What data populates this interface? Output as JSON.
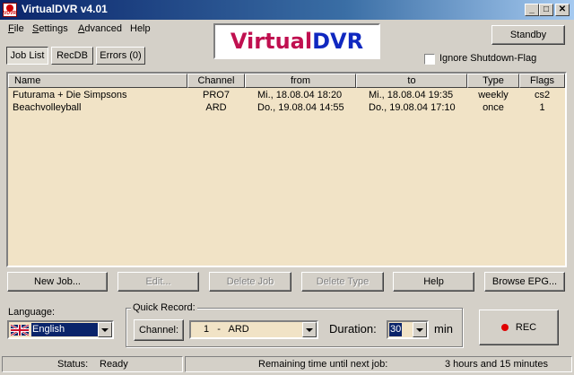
{
  "window": {
    "title": "VirtualDVR v4.01"
  },
  "menu": [
    {
      "label": "File",
      "accel": "F",
      "rest": "ile"
    },
    {
      "label": "Settings",
      "accel": "S",
      "rest": "ettings"
    },
    {
      "label": "Advanced",
      "accel": "A",
      "rest": "dvanced"
    },
    {
      "label": "Help",
      "accel": "",
      "rest": "Help"
    }
  ],
  "tabs": [
    "Job List",
    "RecDB",
    "Errors (0)"
  ],
  "logo": {
    "part1": "Virtual",
    "part2": "DVR"
  },
  "standby_label": "Standby",
  "ignore_shutdown_label": "Ignore Shutdown-Flag",
  "list": {
    "columns": [
      "Name",
      "Channel",
      "from",
      "to",
      "Type",
      "Flags"
    ],
    "rows": [
      {
        "name": "Futurama + Die Simpsons",
        "channel": "PRO7",
        "from": "Mi., 18.08.04  18:20",
        "to": "Mi., 18.08.04  19:35",
        "type": "weekly",
        "flags": "cs2"
      },
      {
        "name": "Beachvolleyball",
        "channel": "ARD",
        "from": "Do., 19.08.04  14:55",
        "to": "Do., 19.08.04  17:10",
        "type": "once",
        "flags": "1"
      }
    ]
  },
  "actions": [
    "New Job...",
    "Edit...",
    "Delete Job",
    "Delete Type",
    "Help",
    "Browse EPG..."
  ],
  "language": {
    "label": "Language:",
    "value": "English"
  },
  "quick_record": {
    "label": "Quick Record:",
    "channel_button": "Channel:",
    "channel_value": "1   -   ARD",
    "duration_label": "Duration:",
    "duration_value": "30",
    "unit": "min"
  },
  "rec_label": "REC",
  "status": {
    "label": "Status:",
    "value": "Ready",
    "remaining_label": "Remaining time until next job:",
    "remaining_value": "3 hours and 15 minutes"
  },
  "colors": {
    "list_bg": "#f1e3c6",
    "rec_dot": "#e00000",
    "logo_virtual": "#c01050",
    "logo_dvr": "#1028c0"
  }
}
